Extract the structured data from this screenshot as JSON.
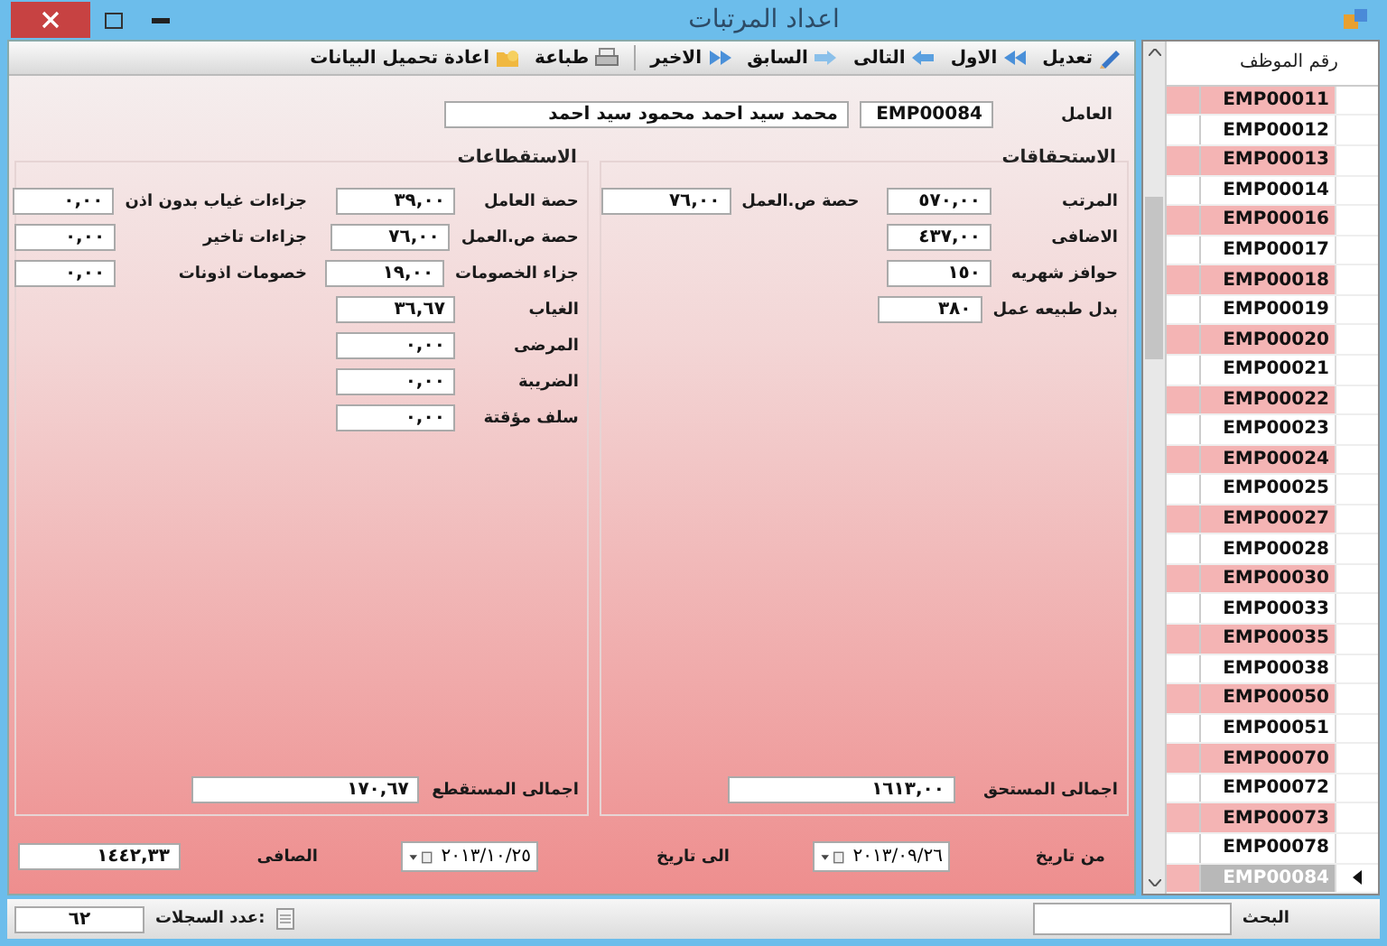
{
  "window": {
    "title": "اعداد المرتبات"
  },
  "toolbar": [
    {
      "kind": "edit",
      "label": "تعديل"
    },
    {
      "kind": "first",
      "label": "الاول"
    },
    {
      "kind": "next",
      "label": "التالى"
    },
    {
      "kind": "previous",
      "label": "السابق"
    },
    {
      "kind": "last",
      "label": "الاخير"
    },
    {
      "kind": "print",
      "label": "طباعة"
    },
    {
      "kind": "reload",
      "label": "اعادة تحميل البيانات"
    }
  ],
  "employee": {
    "label": "العامل",
    "code": "EMP00084",
    "name": "محمد سيد احمد محمود سيد احمد"
  },
  "entitlements": {
    "title": "الاستحقاقات",
    "columns": [
      [
        {
          "label": "المرتب",
          "value": "٥٧٠,٠٠"
        },
        {
          "label": "الاضافى",
          "value": "٤٣٧,٠٠"
        },
        {
          "label": "حوافز شهريه",
          "value": "١٥٠"
        },
        {
          "label": "بدل طبيعه عمل",
          "value": "٣٨٠"
        }
      ],
      [
        {
          "label": "حصة ص.العمل",
          "value": "٧٦,٠٠"
        }
      ]
    ],
    "total": {
      "label": "اجمالى المستحق",
      "value": "١٦١٣,٠٠"
    }
  },
  "deductions": {
    "title": "الاستقطاعات",
    "columns": [
      [
        {
          "label": "حصة العامل",
          "value": "٣٩,٠٠"
        },
        {
          "label": "حصة ص.العمل",
          "value": "٧٦,٠٠"
        },
        {
          "label": "جزاء الخصومات",
          "value": "١٩,٠٠"
        },
        {
          "label": "الغياب",
          "value": "٣٦,٦٧"
        },
        {
          "label": "المرضى",
          "value": "٠,٠٠"
        },
        {
          "label": "الضريبة",
          "value": "٠,٠٠"
        },
        {
          "label": "سلف مؤقتة",
          "value": "٠,٠٠"
        }
      ],
      [
        {
          "label": "جزاءات غياب بدون اذن",
          "value": "٠,٠٠"
        },
        {
          "label": "جزاءات تاخير",
          "value": "٠,٠٠"
        },
        {
          "label": "خصومات اذونات",
          "value": "٠,٠٠"
        }
      ]
    ],
    "total": {
      "label": "اجمالى المستقطع",
      "value": "١٧٠,٦٧"
    }
  },
  "period": {
    "from_label": "من تاريخ",
    "from": "٢٠١٣/٠٩/٢٦",
    "to_label": "الى تاريخ",
    "to": "٢٠١٣/١٠/٢٥",
    "net_label": "الصافى",
    "net": "١٤٤٢,٣٣"
  },
  "employee_list": {
    "header": "رقم الموظف",
    "rows": [
      {
        "code": "EMP00011",
        "selected": false
      },
      {
        "code": "EMP00012",
        "selected": false
      },
      {
        "code": "EMP00013",
        "selected": false
      },
      {
        "code": "EMP00014",
        "selected": false
      },
      {
        "code": "EMP00016",
        "selected": false
      },
      {
        "code": "EMP00017",
        "selected": false
      },
      {
        "code": "EMP00018",
        "selected": false
      },
      {
        "code": "EMP00019",
        "selected": false
      },
      {
        "code": "EMP00020",
        "selected": false
      },
      {
        "code": "EMP00021",
        "selected": false
      },
      {
        "code": "EMP00022",
        "selected": false
      },
      {
        "code": "EMP00023",
        "selected": false
      },
      {
        "code": "EMP00024",
        "selected": false
      },
      {
        "code": "EMP00025",
        "selected": false
      },
      {
        "code": "EMP00027",
        "selected": false
      },
      {
        "code": "EMP00028",
        "selected": false
      },
      {
        "code": "EMP00030",
        "selected": false
      },
      {
        "code": "EMP00033",
        "selected": false
      },
      {
        "code": "EMP00035",
        "selected": false
      },
      {
        "code": "EMP00038",
        "selected": false
      },
      {
        "code": "EMP00050",
        "selected": false
      },
      {
        "code": "EMP00051",
        "selected": false
      },
      {
        "code": "EMP00070",
        "selected": false
      },
      {
        "code": "EMP00072",
        "selected": false
      },
      {
        "code": "EMP00073",
        "selected": false
      },
      {
        "code": "EMP00078",
        "selected": false
      },
      {
        "code": "EMP00084",
        "selected": true
      }
    ]
  },
  "status_bar": {
    "count_label": "عدد السجلات:",
    "count": "٦٢",
    "search_label": "البحث"
  }
}
